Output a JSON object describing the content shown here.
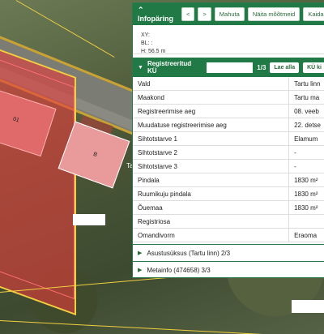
{
  "map": {
    "labels": {
      "parcel_a": "01",
      "parcel_b": "B",
      "side_label": "Ta"
    }
  },
  "panel": {
    "title": "Infopäring",
    "buttons": [
      "<",
      ">",
      "Mahuta",
      "Näita mõõtmeid",
      "Kaida"
    ],
    "coords": {
      "xy": "XY:",
      "bl": "BL: :",
      "h": "H: 56.5 m"
    },
    "section": {
      "title": "Registreeritud KÜ",
      "counter": "1/3",
      "buttons": [
        "Lae alla",
        "KÜ ki"
      ]
    },
    "rows": [
      {
        "key": "Vald",
        "value": "Tartu linn"
      },
      {
        "key": "Maakond",
        "value": "Tartu ma"
      },
      {
        "key": "Registreerimise aeg",
        "value": "08. veeb"
      },
      {
        "key": "Muudatuse registreerimise aeg",
        "value": "22. detse"
      },
      {
        "key": "Sihtotstarve 1",
        "value": "Elamum"
      },
      {
        "key": "Sihtotstarve 2",
        "value": "-"
      },
      {
        "key": "Sihtotstarve 3",
        "value": "-"
      },
      {
        "key": "Pindala",
        "value": "1830 m²"
      },
      {
        "key": "Ruumikuju pindala",
        "value": "1830 m²"
      },
      {
        "key": "Õuemaa",
        "value": "1830 m²"
      },
      {
        "key": "Registriosa",
        "value": ""
      },
      {
        "key": "Omandivorm",
        "value": "Eraoma"
      }
    ],
    "subsections": [
      "Asustusüksus (Tartu linn) 2/3",
      "Metainfo (474658) 3/3"
    ]
  }
}
